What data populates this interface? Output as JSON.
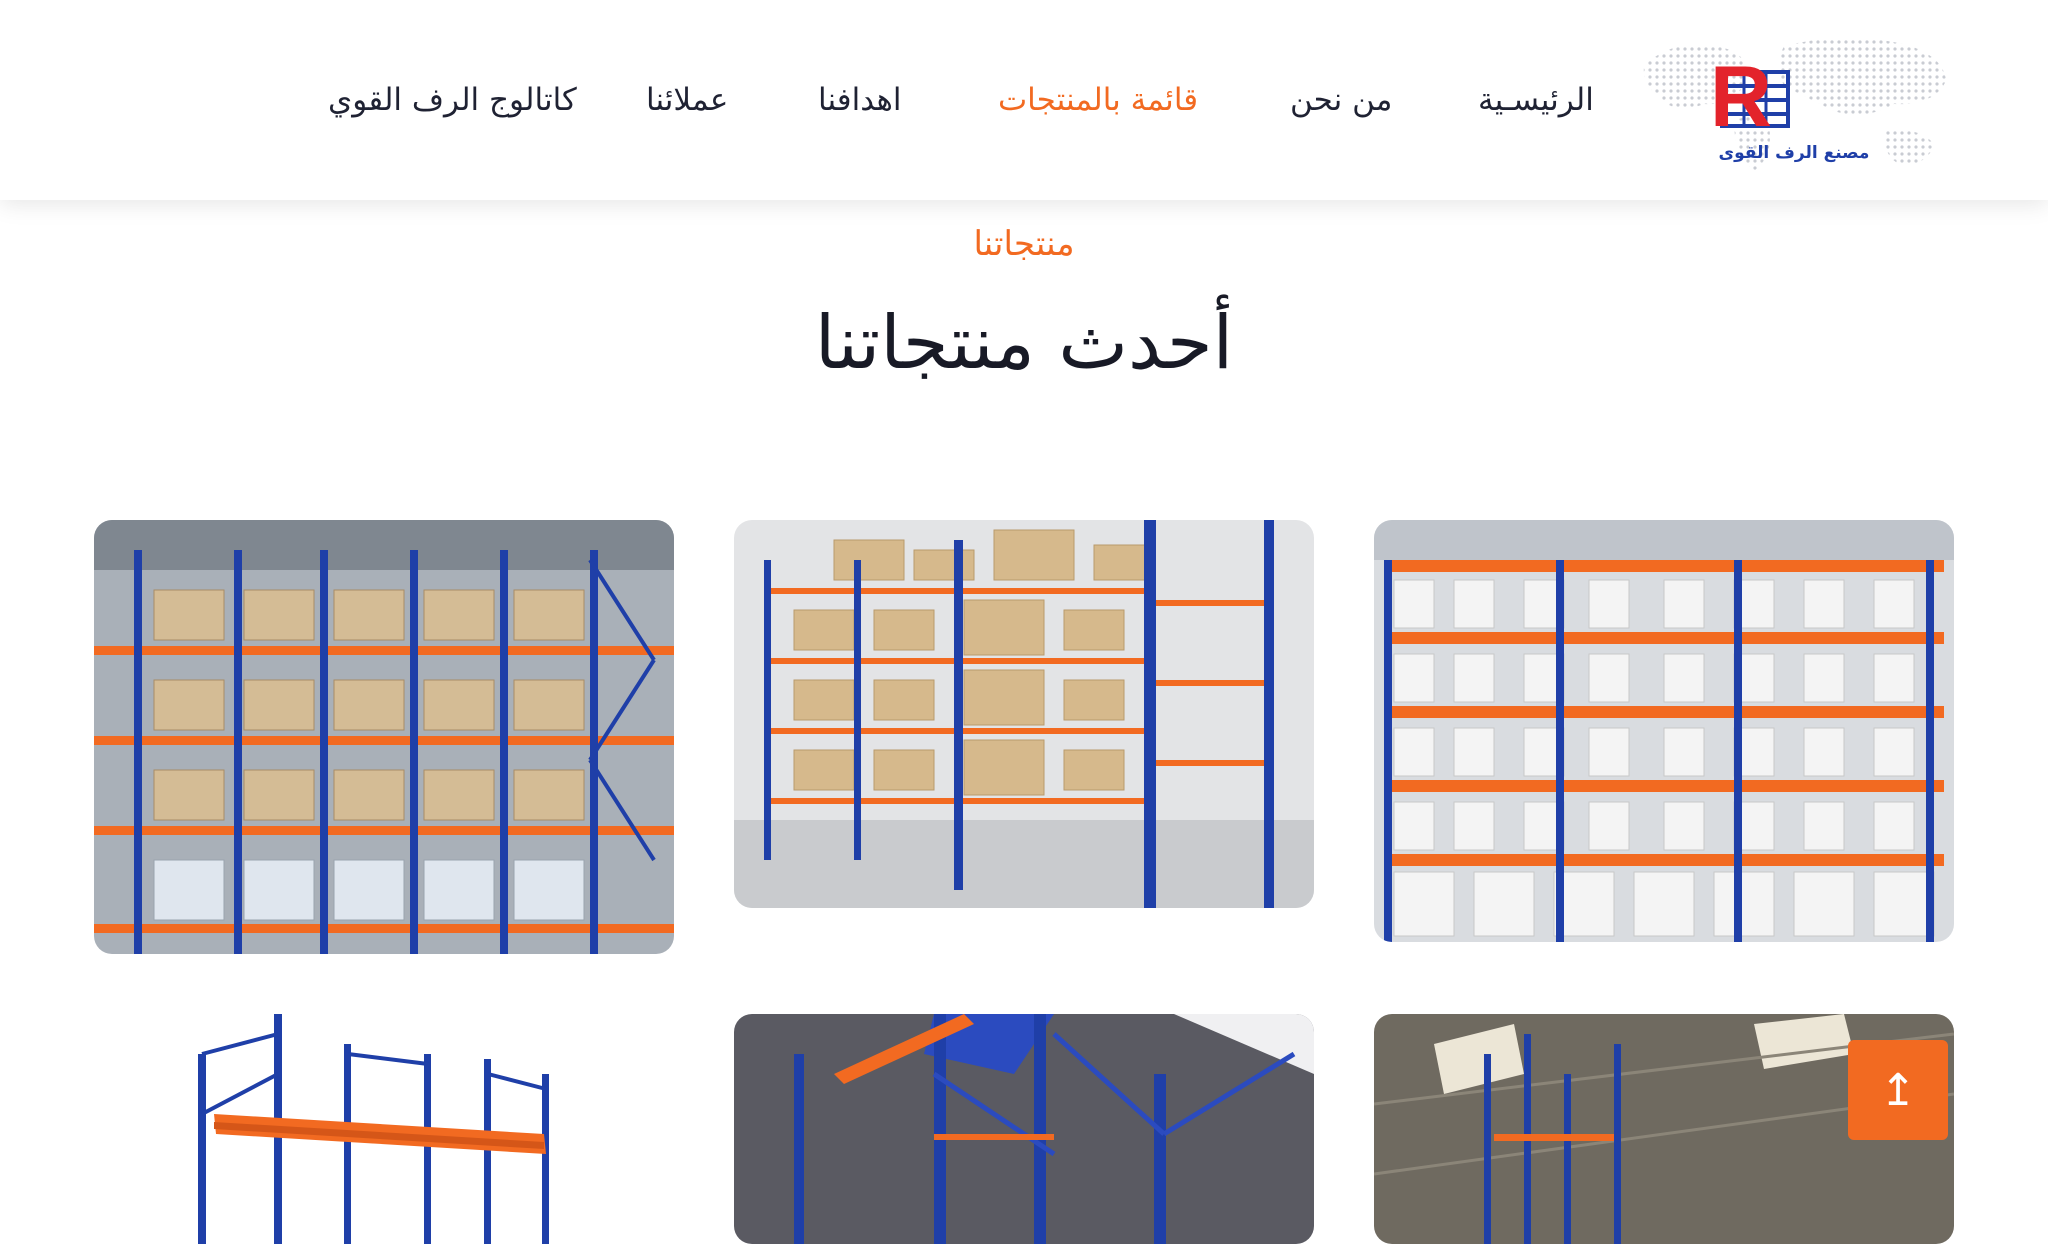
{
  "brand": {
    "logo_text": "مصنع الرف القوى",
    "logo_letter": "R"
  },
  "nav": {
    "home": "الرئيسـية",
    "about": "من نحن",
    "products": "قائمة بالمنتجات",
    "goals": "اهدافنا",
    "clients": "عملائنا",
    "catalog": "كاتالوج الرف القوي",
    "active_item": "products"
  },
  "section": {
    "eyebrow": "منتجاتنا",
    "title": "أحدث منتجاتنا"
  },
  "products": [
    {
      "image": "pallet-racking-orange-blue-white-boxes"
    },
    {
      "image": "long-span-shelving-warehouse-aisle"
    },
    {
      "image": "pallet-racking-loaded-warehouse"
    },
    {
      "image": "interior-racking-under-skylight"
    },
    {
      "image": "mezzanine-racking-blue-structure"
    },
    {
      "image": "isolated-pallet-rack-frame"
    }
  ],
  "scroll_top": {
    "icon": "arrow-up-icon",
    "glyph": "↥"
  },
  "colors": {
    "accent": "#f26a21",
    "rack_blue": "#1f3fa8",
    "rack_orange": "#f26a21",
    "text": "#1b1d2a"
  }
}
